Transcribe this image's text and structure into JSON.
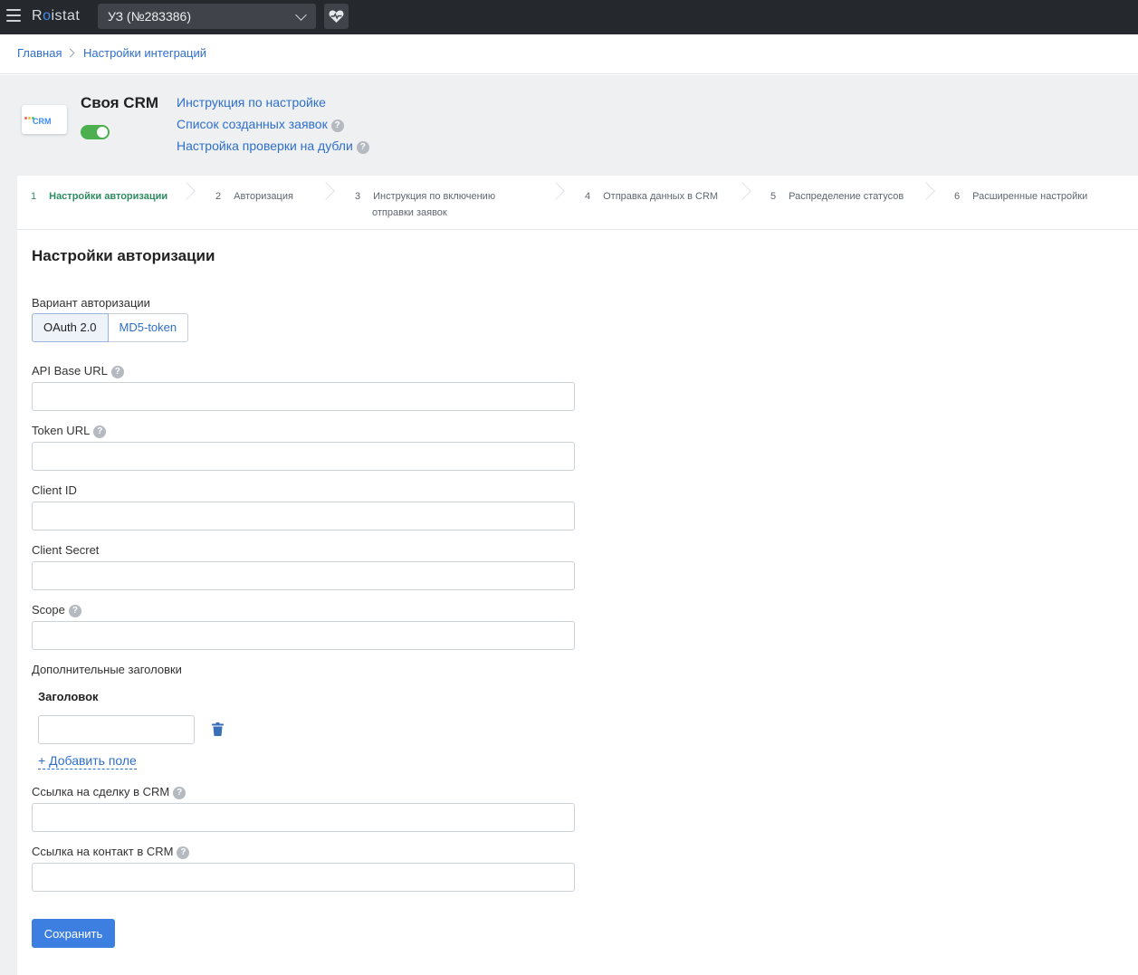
{
  "topbar": {
    "logo": "Roistat",
    "project": "УЗ (№283386)"
  },
  "breadcrumb": {
    "home": "Главная",
    "current": "Настройки интеграций"
  },
  "header": {
    "logo_text": "CRM",
    "title": "Своя CRM",
    "enabled": true,
    "links": [
      "Инструкция по настройке",
      "Список созданных заявок",
      "Настройка проверки на дубли"
    ]
  },
  "steps": [
    {
      "num": "1",
      "label": "Настройки авторизации"
    },
    {
      "num": "2",
      "label": "Авторизация"
    },
    {
      "num": "3",
      "label_line1": "Инструкция по включению",
      "label_line2": "отправки заявок"
    },
    {
      "num": "4",
      "label": "Отправка данных в CRM"
    },
    {
      "num": "5",
      "label": "Распределение статусов"
    },
    {
      "num": "6",
      "label": "Расширенные настройки"
    }
  ],
  "form": {
    "title": "Настройки авторизации",
    "auth_variant_label": "Вариант авторизации",
    "auth_options": [
      "OAuth 2.0",
      "MD5-token"
    ],
    "selected_auth": "OAuth 2.0",
    "fields": {
      "api_base_url": {
        "label": "API Base URL",
        "value": ""
      },
      "token_url": {
        "label": "Token URL",
        "value": ""
      },
      "client_id": {
        "label": "Client ID",
        "value": ""
      },
      "client_secret": {
        "label": "Client Secret",
        "value": ""
      },
      "scope": {
        "label": "Scope",
        "value": ""
      },
      "deal_link": {
        "label": "Ссылка на сделку в CRM",
        "value": ""
      },
      "contact_link": {
        "label": "Ссылка на контакт в CRM",
        "value": ""
      }
    },
    "extra_headers_label": "Дополнительные заголовки",
    "header_column": "Заголовок",
    "add_field": "+ Добавить поле",
    "save": "Сохранить"
  },
  "colors": {
    "topbar": "#25282d",
    "link": "#2f6fc9",
    "active_step": "#2e8b62",
    "toggle_on": "#4caf50",
    "primary_button": "#3d7fe0"
  }
}
